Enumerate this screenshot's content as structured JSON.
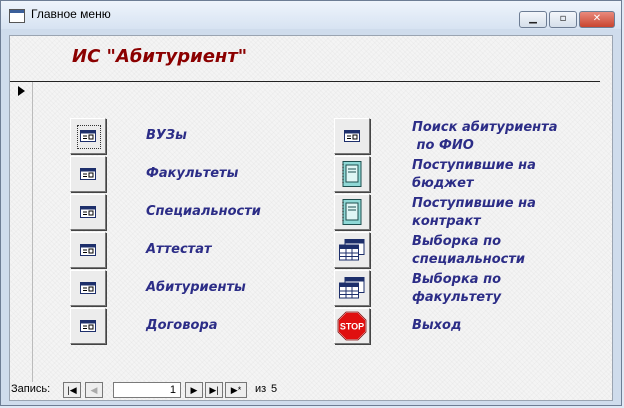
{
  "window": {
    "title": "Главное меню"
  },
  "header": {
    "title": "ИС \"Абитуриент\""
  },
  "left_column": [
    {
      "label": "ВУЗы",
      "icon": "form-icon"
    },
    {
      "label": "Факультеты",
      "icon": "form-icon"
    },
    {
      "label": "Специальности",
      "icon": "form-icon"
    },
    {
      "label": "Аттестат",
      "icon": "form-icon"
    },
    {
      "label": "Абитуриенты",
      "icon": "form-icon"
    },
    {
      "label": "Договора",
      "icon": "form-icon"
    }
  ],
  "right_column": [
    {
      "label_line1": "Поиск абитуриента",
      "label_line2": " по ФИО",
      "icon": "form-icon"
    },
    {
      "label_line1": "Поступившие на",
      "label_line2": "бюджет",
      "icon": "report-icon"
    },
    {
      "label_line1": "Поступившие на",
      "label_line2": "контракт",
      "icon": "report-icon"
    },
    {
      "label_line1": "Выборка по",
      "label_line2": "специальности",
      "icon": "query-icon"
    },
    {
      "label_line1": "Выборка по",
      "label_line2": "факультету",
      "icon": "query-icon"
    },
    {
      "label_line1": "Выход",
      "label_line2": "",
      "icon": "stop-icon"
    }
  ],
  "navigation": {
    "label": "Запись:",
    "current": "1",
    "of_label": "из",
    "total": "5"
  },
  "colors": {
    "title": "#8b0000",
    "labels": "#2c2d87"
  }
}
